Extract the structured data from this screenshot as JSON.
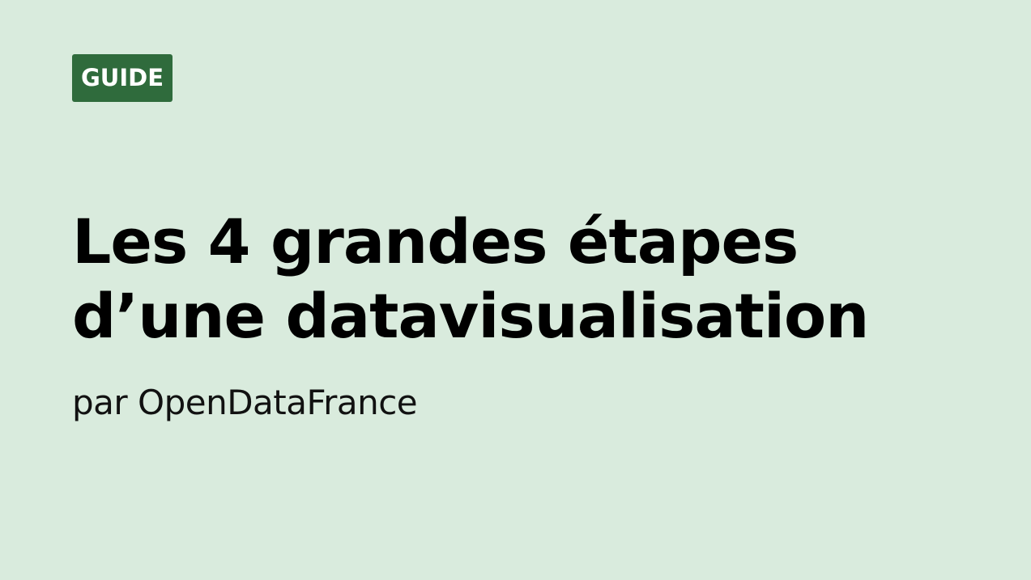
{
  "colors": {
    "background": "#d9ebdd",
    "badge_background": "#2f6b3c",
    "badge_text": "#ffffff",
    "title_text": "#000000",
    "subtitle_text": "#111111"
  },
  "badge": {
    "label": "GUIDE"
  },
  "title": {
    "line1": "Les 4 grandes étapes",
    "line2": "d’une datavisualisation"
  },
  "subtitle": {
    "text": "par OpenDataFrance"
  }
}
